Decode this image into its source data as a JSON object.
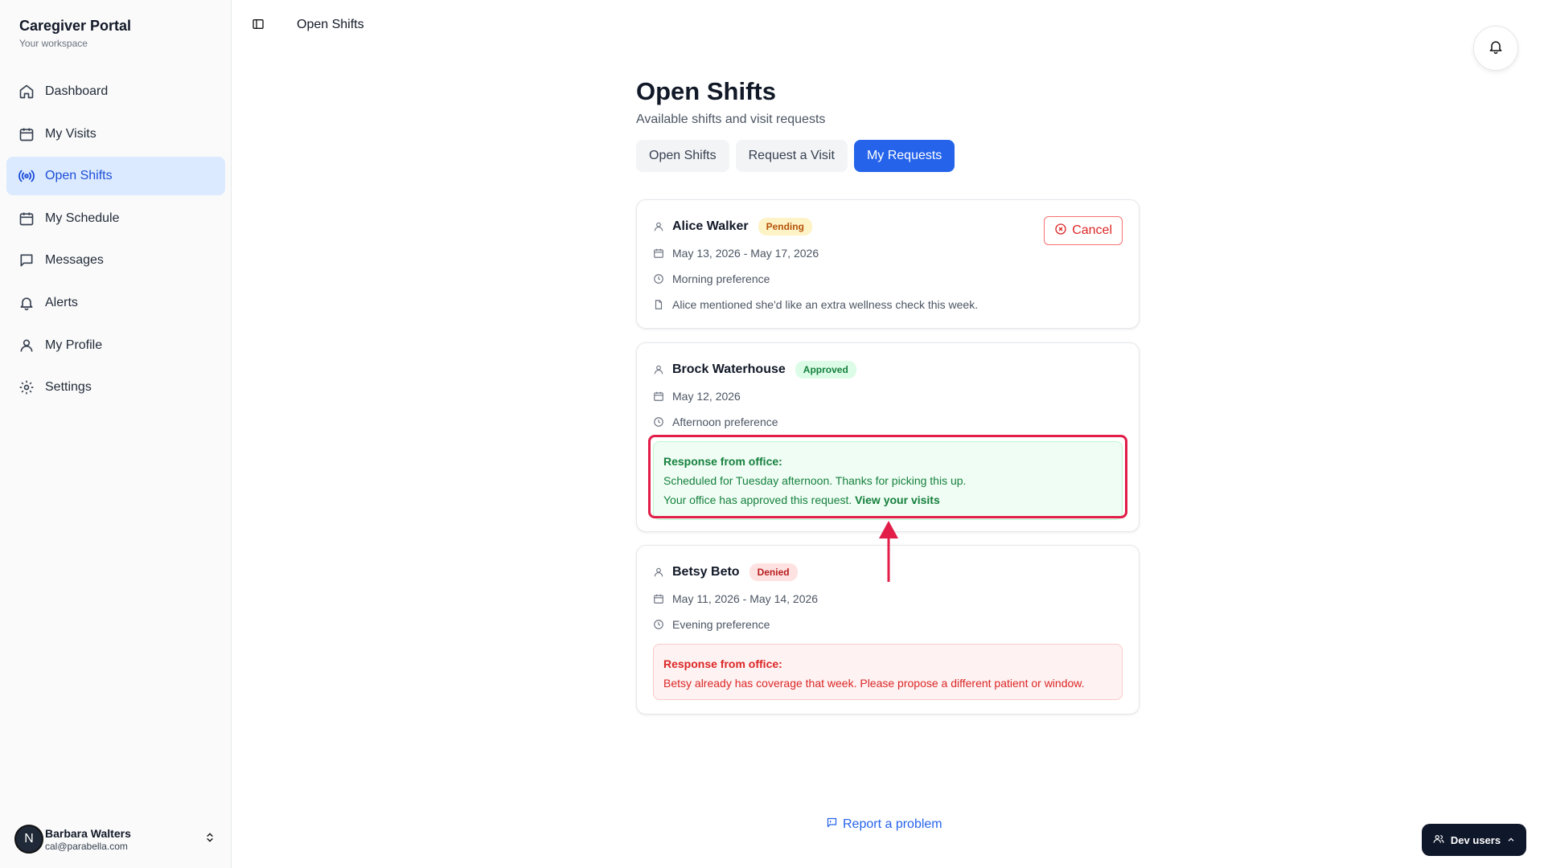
{
  "sidebar": {
    "brand_title": "Caregiver Portal",
    "brand_sub": "Your workspace",
    "items": [
      {
        "label": "Dashboard",
        "icon": "home-icon"
      },
      {
        "label": "My Visits",
        "icon": "calendar-icon"
      },
      {
        "label": "Open Shifts",
        "icon": "broadcast-icon",
        "active": true
      },
      {
        "label": "My Schedule",
        "icon": "calendar-icon"
      },
      {
        "label": "Messages",
        "icon": "message-icon"
      },
      {
        "label": "Alerts",
        "icon": "bell-icon"
      },
      {
        "label": "My Profile",
        "icon": "user-icon"
      },
      {
        "label": "Settings",
        "icon": "gear-icon"
      }
    ],
    "user": {
      "avatar_letter": "N",
      "name": "Barbara Walters",
      "email": "cal@parabella.com"
    }
  },
  "topbar": {
    "breadcrumb": "Open Shifts"
  },
  "page": {
    "title": "Open Shifts",
    "subtitle": "Available shifts and visit requests",
    "tabs": [
      {
        "label": "Open Shifts"
      },
      {
        "label": "Request a Visit"
      },
      {
        "label": "My Requests",
        "active": true
      }
    ]
  },
  "requests": [
    {
      "name": "Alice Walker",
      "status": "Pending",
      "dates": "May 13, 2026 - May 17, 2026",
      "preference": "Morning preference",
      "note": "Alice mentioned she'd like an extra wellness check this week.",
      "cancel_label": "Cancel"
    },
    {
      "name": "Brock Waterhouse",
      "status": "Approved",
      "dates": "May 12, 2026",
      "preference": "Afternoon preference",
      "response_head": "Response from office:",
      "response_text": "Scheduled for Tuesday afternoon. Thanks for picking this up.",
      "response_extra": "Your office has approved this request.",
      "response_link": "View your visits"
    },
    {
      "name": "Betsy Beto",
      "status": "Denied",
      "dates": "May 11, 2026 - May 14, 2026",
      "preference": "Evening preference",
      "response_head": "Response from office:",
      "response_text": "Betsy already has coverage that week. Please propose a different patient or window."
    }
  ],
  "footer": {
    "report": "Report a problem",
    "dev_users": "Dev users"
  },
  "colors": {
    "accent": "#2563eb",
    "highlight": "#e11d48",
    "approved": "#15803d",
    "denied": "#dc2626",
    "pending": "#b45309"
  }
}
